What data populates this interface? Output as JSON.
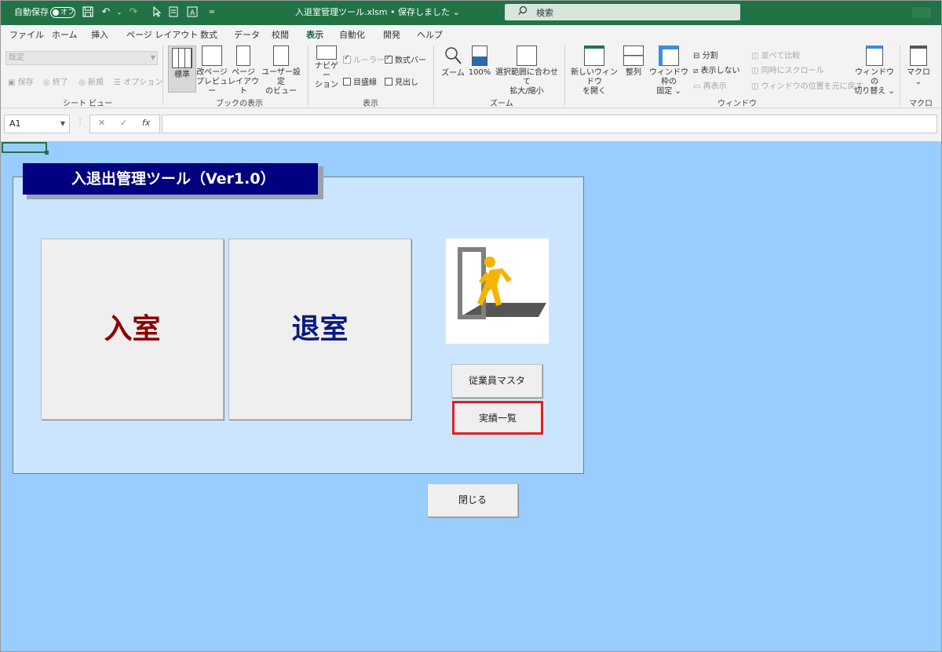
{
  "titlebar": {
    "autosave_label": "自動保存",
    "autosave_state": "オフ",
    "doc_title": "入退室管理ツール.xlsm • 保存しました ⌄",
    "search_placeholder": "検索"
  },
  "menu": {
    "tabs": [
      "ファイル",
      "ホーム",
      "挿入",
      "ページ レイアウト",
      "数式",
      "データ",
      "校閲",
      "表示",
      "自動化",
      "開発",
      "ヘルプ"
    ],
    "active": "表示"
  },
  "ribbon": {
    "sheet_view": {
      "combo_value": "既定",
      "keep": "保存",
      "exit": "終了",
      "new": "新規",
      "options": "オプション",
      "label": "シート ビュー"
    },
    "workbook_views": {
      "normal": "標準",
      "page_break_1": "改ページ",
      "page_break_2": "プレビュー",
      "page_layout_1": "ページ",
      "page_layout_2": "レイアウト",
      "custom_1": "ユーザー設定",
      "custom_2": "のビュー",
      "label": "ブックの表示"
    },
    "show": {
      "nav_1": "ナビゲー",
      "nav_2": "ション",
      "ruler": "ルーラー",
      "formula_bar": "数式バー",
      "gridlines": "目盛線",
      "headings": "見出し",
      "label": "表示"
    },
    "zoom": {
      "zoom": "ズーム",
      "hundred": "100%",
      "sel_1": "選択範囲に合わせて",
      "sel_2": "拡大/縮小",
      "label": "ズーム"
    },
    "window": {
      "new_1": "新しいウィンドウ",
      "new_2": "を開く",
      "arrange": "整列",
      "freeze_1": "ウィンドウ枠の",
      "freeze_2": "固定 ⌄",
      "split": "分割",
      "hide": "表示しない",
      "unhide": "再表示",
      "side_by_side": "並べて比較",
      "sync_scroll": "同時にスクロール",
      "reset_pos": "ウィンドウの位置を元に戻す",
      "switch_1": "ウィンドウの",
      "switch_2": "切り替え ⌄",
      "label": "ウィンドウ"
    },
    "macros": {
      "macro": "マクロ",
      "caret": "⌄",
      "label": "マクロ"
    }
  },
  "formula_bar": {
    "name_box": "A1",
    "cancel": "✕",
    "enter": "✓",
    "fx": "fx",
    "value": ""
  },
  "sheet": {
    "panel_title": "入退出管理ツール（Ver1.0）",
    "enter_button": "入室",
    "exit_button": "退室",
    "employee_master_button": "従業員マスタ",
    "results_list_button": "実績一覧",
    "close_button": "閉じる"
  },
  "colors": {
    "excel_green": "#217346",
    "sheet_bg": "#99ccff",
    "panel_bg": "#cce5ff",
    "title_bg": "#000080",
    "enter_text": "#8b0000",
    "exit_text": "#0a1a80",
    "highlight_border": "#e02020",
    "figure_yellow": "#f5b400"
  }
}
